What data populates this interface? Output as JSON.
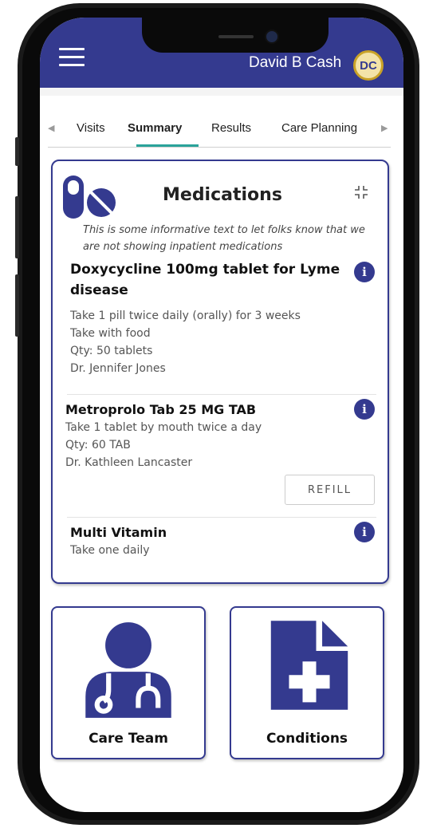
{
  "header": {
    "partial_label": "g:",
    "user_name": "David B Cash",
    "avatar_initials": "DC"
  },
  "tabs": [
    {
      "label": "Visits",
      "active": false
    },
    {
      "label": "Summary",
      "active": true
    },
    {
      "label": "Results",
      "active": false
    },
    {
      "label": "Care Planning",
      "active": false
    }
  ],
  "medications": {
    "title": "Medications",
    "info_text": "This is some informative text to let folks know that we are not showing inpatient medications",
    "items": [
      {
        "name_line1": "Doxycycline 100mg tablet for Lyme",
        "name_line2": "disease",
        "details": [
          "Take 1 pill twice daily (orally) for 3 weeks",
          "Take with food",
          "Qty: 50 tablets",
          "Dr. Jennifer Jones"
        ]
      },
      {
        "name_line1": "Metroprolo Tab 25 MG TAB",
        "details": [
          "Take 1 tablet by mouth twice a day",
          "Qty: 60 TAB",
          "Dr. Kathleen Lancaster"
        ],
        "action_label": "REFILL"
      },
      {
        "name_line1": "Multi Vitamin",
        "details": [
          "Take one daily"
        ]
      }
    ]
  },
  "tiles": [
    {
      "label": "Care Team",
      "icon": "doctor-icon"
    },
    {
      "label": "Conditions",
      "icon": "medical-document-icon"
    }
  ],
  "colors": {
    "primary": "#343a8f",
    "accent": "#2aa39a",
    "avatar_bg": "#f3e3a8",
    "avatar_ring": "#c9a227"
  }
}
